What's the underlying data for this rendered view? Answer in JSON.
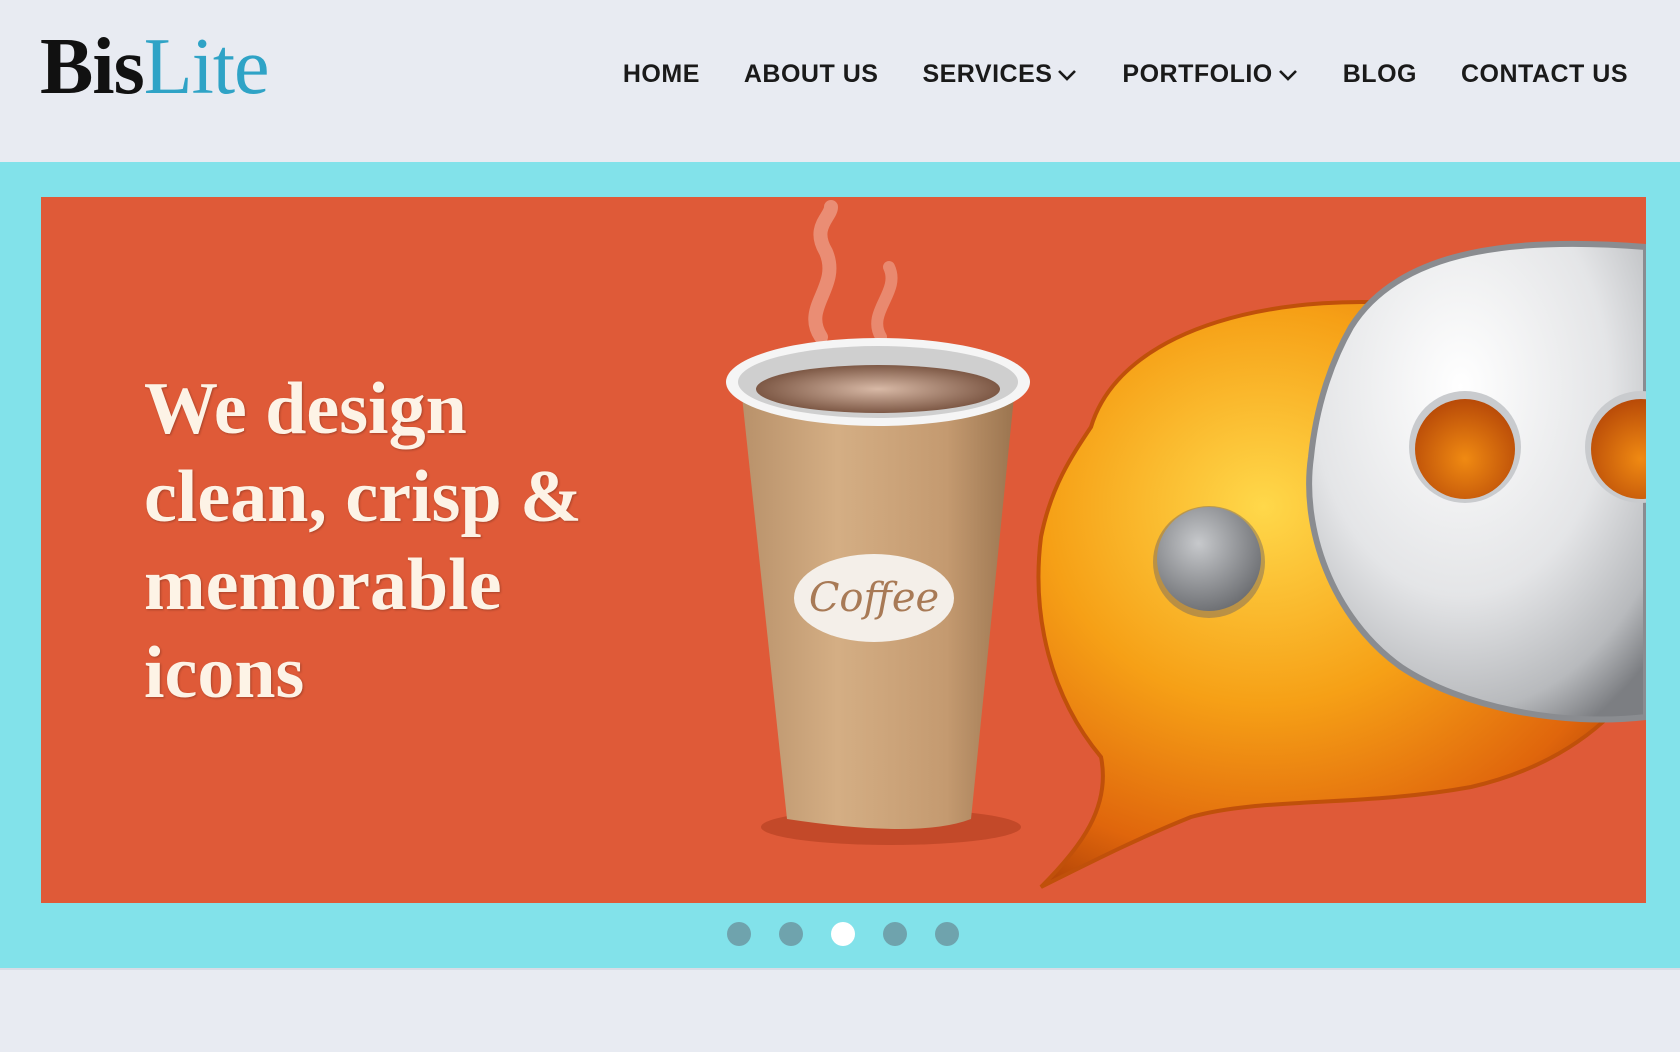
{
  "header": {
    "logo": {
      "part1": "Bis",
      "part2": "Lite"
    },
    "nav": [
      {
        "label": "HOME",
        "dropdown": false
      },
      {
        "label": "ABOUT US",
        "dropdown": false
      },
      {
        "label": "SERVICES",
        "dropdown": true
      },
      {
        "label": "PORTFOLIO",
        "dropdown": true
      },
      {
        "label": "BLOG",
        "dropdown": false
      },
      {
        "label": "CONTACT US",
        "dropdown": false
      }
    ]
  },
  "slider": {
    "headline_lines": [
      "We design",
      "clean, crisp &",
      "memorable",
      "icons"
    ],
    "cup_label": "Coffee",
    "dots_count": 5,
    "active_dot": 3,
    "colors": {
      "frame": "#82e2ea",
      "slide_bg": "#df5a38",
      "dot": "#6fa3ad",
      "dot_active": "#ffffff"
    }
  }
}
